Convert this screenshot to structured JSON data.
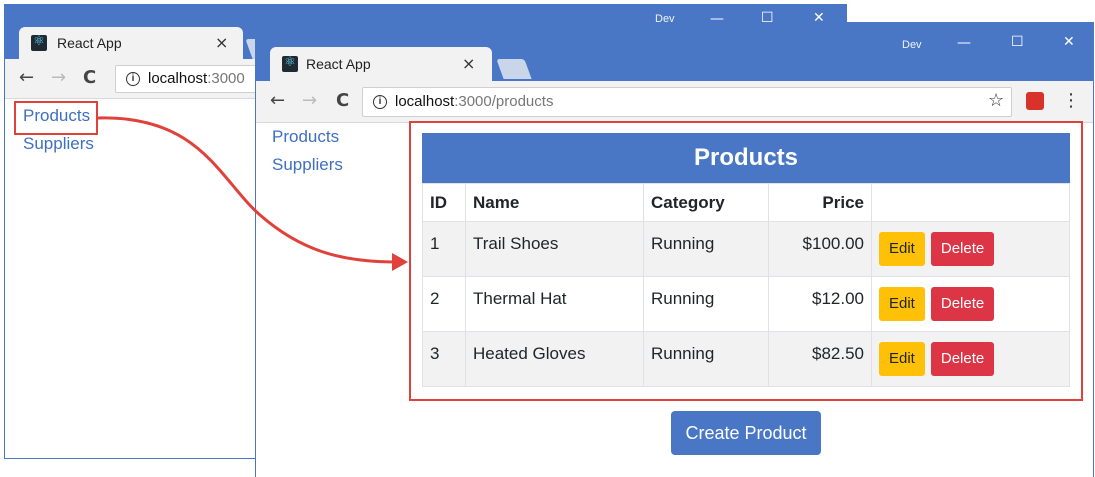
{
  "browser": {
    "tab_title": "React App",
    "close_glyph": "×",
    "profile_name": "Dev",
    "window_controls": {
      "minimize": "—",
      "maximize": "☐",
      "close": "✕"
    },
    "nav": {
      "back": "←",
      "forward": "→",
      "reload": "C"
    },
    "info_glyph": "i",
    "star_glyph": "☆",
    "menu_glyph": "⋮"
  },
  "back_window": {
    "url_host": "localhost",
    "url_rest": ":3000",
    "links": [
      "Products",
      "Suppliers"
    ]
  },
  "front_window": {
    "url_host": "localhost",
    "url_rest": ":3000/products",
    "links": [
      "Products",
      "Suppliers"
    ],
    "table": {
      "title": "Products",
      "columns": [
        "ID",
        "Name",
        "Category",
        "Price"
      ],
      "rows": [
        {
          "id": "1",
          "name": "Trail Shoes",
          "category": "Running",
          "price": "$100.00"
        },
        {
          "id": "2",
          "name": "Thermal Hat",
          "category": "Running",
          "price": "$12.00"
        },
        {
          "id": "3",
          "name": "Heated Gloves",
          "category": "Running",
          "price": "$82.50"
        }
      ],
      "edit_label": "Edit",
      "delete_label": "Delete"
    },
    "create_label": "Create Product"
  },
  "colors": {
    "chrome_blue": "#4a77c5",
    "annotation_red": "#e0413a",
    "edit_yellow": "#ffc107",
    "delete_red": "#dc3545"
  }
}
